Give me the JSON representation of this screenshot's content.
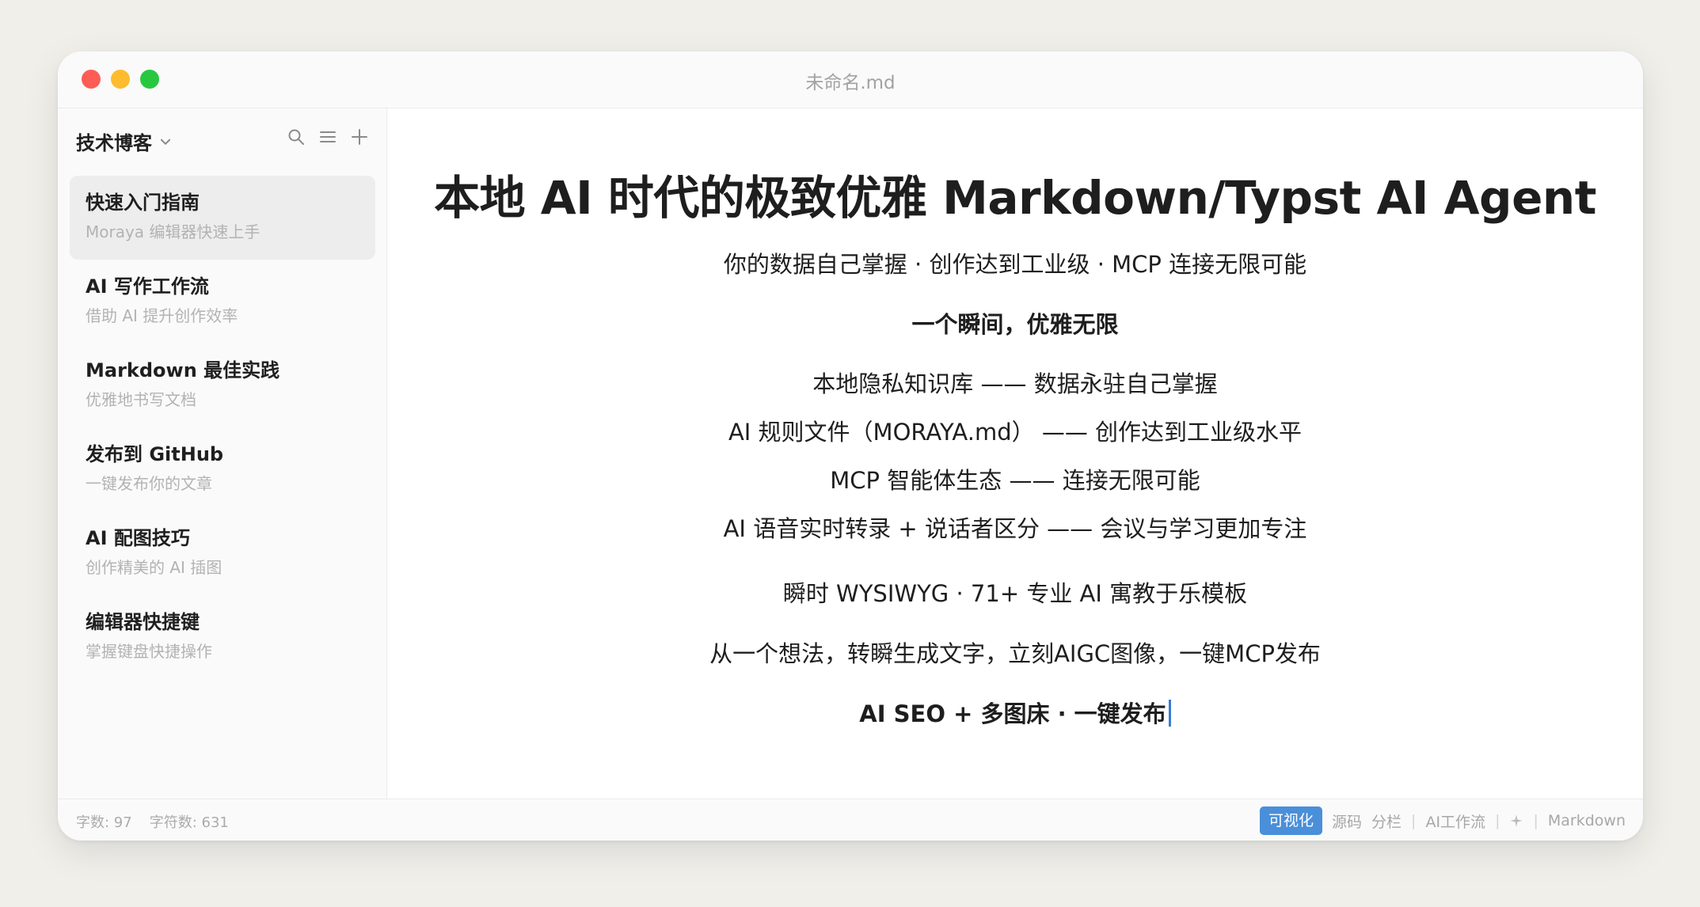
{
  "window": {
    "title": "未命名.md"
  },
  "sidebar": {
    "workspace": "技术博客",
    "notes": [
      {
        "title": "快速入门指南",
        "subtitle": "Moraya 编辑器快速上手",
        "active": true
      },
      {
        "title": "AI 写作工作流",
        "subtitle": "借助 AI 提升创作效率"
      },
      {
        "title": "Markdown 最佳实践",
        "subtitle": "优雅地书写文档"
      },
      {
        "title": "发布到 GitHub",
        "subtitle": "一键发布你的文章"
      },
      {
        "title": "AI 配图技巧",
        "subtitle": "创作精美的 AI 插图"
      },
      {
        "title": "编辑器快捷键",
        "subtitle": "掌握键盘快捷操作"
      }
    ]
  },
  "document": {
    "title": "本地 AI 时代的极致优雅 Markdown/Typst AI Agent",
    "tagline": "你的数据自己掌握 · 创作达到工业级 · MCP 连接无限可能",
    "slogan": "一个瞬间，优雅无限",
    "features": [
      "本地隐私知识库 —— 数据永驻自己掌握",
      "AI 规则文件（MORAYA.md） —— 创作达到工业级水平",
      "MCP 智能体生态 —— 连接无限可能",
      "AI 语音实时转录 + 说话者区分 —— 会议与学习更加专注"
    ],
    "templates_line": "瞬时 WYSIWYG · 71+ 专业 AI 寓教于乐模板",
    "flow_line": "从一个想法，转瞬生成文字，立刻AIGC图像，一键MCP发布",
    "closing": "AI SEO + 多图床 · 一键发布"
  },
  "status": {
    "word_count": "字数: 97",
    "char_count": "字符数: 631",
    "modes": {
      "visual": "可视化",
      "source": "源码",
      "split": "分栏"
    },
    "ai_workflow": "AI工作流",
    "format": "Markdown"
  },
  "colors": {
    "accent": "#4a8fd9",
    "caret": "#3a7bd5"
  },
  "icons": [
    "chevron-down-icon",
    "search-icon",
    "list-icon",
    "plus-icon",
    "sparkle-icon"
  ]
}
